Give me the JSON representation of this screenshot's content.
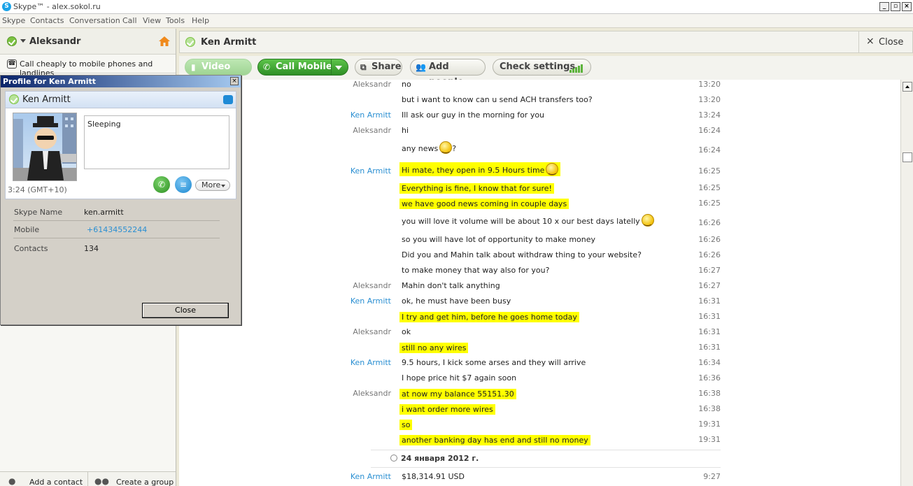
{
  "window": {
    "title": "Skype™ - alex.sokol.ru",
    "menu": [
      "Skype",
      "Contacts",
      "Conversation",
      "Call",
      "View",
      "Tools",
      "Help"
    ]
  },
  "sidebar": {
    "user_name": "Aleksandr",
    "call_promo": "Call cheaply to mobile phones and landlines",
    "add_contact": "Add a contact",
    "create_group": "Create a group"
  },
  "conversation": {
    "contact_name": "Ken Armitt",
    "close_label": "Close",
    "toolbar": {
      "video_call": "Video call",
      "call_mobile": "Call Mobile",
      "share": "Share",
      "add_people": "Add people",
      "check_settings": "Check settings"
    },
    "messages": [
      {
        "sender": "Aleksandr",
        "text": "no",
        "time": "13:20",
        "highlight": false,
        "smiley": false
      },
      {
        "sender": "",
        "text": "but i want to know can u send ACH transfers too?",
        "time": "13:20",
        "highlight": false,
        "smiley": false
      },
      {
        "sender": "Ken Armitt",
        "text": "Ill ask our guy in the morning for you",
        "time": "13:24",
        "highlight": false,
        "smiley": false
      },
      {
        "sender": "Aleksandr",
        "text": "hi",
        "time": "16:24",
        "highlight": false,
        "smiley": false
      },
      {
        "sender": "",
        "text": "any news",
        "suffix": "?",
        "time": "16:24",
        "highlight": false,
        "smiley": true
      },
      {
        "sender": "Ken Armitt",
        "text": "Hi mate, they open in 9.5 Hours time",
        "time": "16:25",
        "highlight": true,
        "smiley": true
      },
      {
        "sender": "",
        "text": "Everything is fine, I know that for sure!",
        "time": "16:25",
        "highlight": true,
        "smiley": false
      },
      {
        "sender": "",
        "text": "we have good news coming in couple days",
        "time": "16:25",
        "highlight": true,
        "smiley": false
      },
      {
        "sender": "",
        "text": "you will love it volume will be about 10 x our best days latelly",
        "time": "16:26",
        "highlight": false,
        "smiley": true
      },
      {
        "sender": "",
        "text": "so you will have lot of opportunity to make money",
        "time": "16:26",
        "highlight": false,
        "smiley": false
      },
      {
        "sender": "",
        "text": "Did you and Mahin talk about withdraw thing to your website?",
        "time": "16:26",
        "highlight": false,
        "smiley": false
      },
      {
        "sender": "",
        "text": "to make money that way also for you?",
        "time": "16:27",
        "highlight": false,
        "smiley": false
      },
      {
        "sender": "Aleksandr",
        "text": "Mahin don't talk anything",
        "time": "16:27",
        "highlight": false,
        "smiley": false
      },
      {
        "sender": "Ken Armitt",
        "text": "ok, he must have been busy",
        "time": "16:31",
        "highlight": false,
        "smiley": false
      },
      {
        "sender": "",
        "text": "I try and get him, before he goes home today",
        "time": "16:31",
        "highlight": true,
        "smiley": false
      },
      {
        "sender": "Aleksandr",
        "text": "ok",
        "time": "16:31",
        "highlight": false,
        "smiley": false
      },
      {
        "sender": "",
        "text": "still no any wires",
        "time": "16:31",
        "highlight": true,
        "smiley": false
      },
      {
        "sender": "Ken Armitt",
        "text": "9.5 hours, I kick some arses and they will arrive",
        "time": "16:34",
        "highlight": false,
        "smiley": false
      },
      {
        "sender": "",
        "text": "I hope price hit $7 again soon",
        "time": "16:36",
        "highlight": false,
        "smiley": false
      },
      {
        "sender": "Aleksandr",
        "text": "at now my balance 55151.30",
        "time": "16:38",
        "highlight": true,
        "smiley": false
      },
      {
        "sender": "",
        "text": "i want order more wires",
        "time": "16:38",
        "highlight": true,
        "smiley": false
      },
      {
        "sender": "",
        "text": "so",
        "time": "19:31",
        "highlight": true,
        "smiley": false
      },
      {
        "sender": "",
        "text": "another banking day has end and still no money",
        "time": "19:31",
        "highlight": true,
        "smiley": false
      }
    ],
    "date_separator": "24 января 2012 г.",
    "last_message": {
      "sender": "Ken Armitt",
      "text": "$18,314.91 USD",
      "time": "9:27"
    }
  },
  "profile": {
    "window_title": "Profile for Ken Armitt",
    "name": "Ken Armitt",
    "mood": "Sleeping",
    "more_label": "More",
    "local_time": "3:24 (GMT+10)",
    "fields": [
      {
        "label": "Skype Name",
        "value": "ken.armitt",
        "link": false
      },
      {
        "label": "Mobile",
        "value": "+61434552244",
        "link": true
      },
      {
        "label": "Contacts",
        "value": "134",
        "link": false
      }
    ],
    "close_label": "Close"
  }
}
